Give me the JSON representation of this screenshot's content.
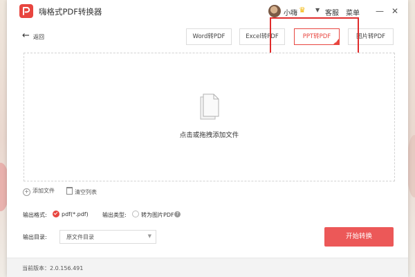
{
  "app": {
    "title": "嗨格式PDF转换器"
  },
  "user": {
    "name": "小嗨"
  },
  "header": {
    "service": "客服",
    "menu": "菜单",
    "minimize": "—",
    "close": "✕"
  },
  "nav": {
    "back_label": "返回"
  },
  "tabs": [
    {
      "label": "Word转PDF",
      "active": false
    },
    {
      "label": "Excel转PDF",
      "active": false
    },
    {
      "label": "PPT转PDF",
      "active": true
    },
    {
      "label": "图片转PDF",
      "active": false
    }
  ],
  "dropzone": {
    "text": "点击或拖拽添加文件"
  },
  "list_actions": {
    "add": "添加文件",
    "clear": "清空列表"
  },
  "options": {
    "format_label": "输出格式:",
    "format_value": "pdf(*.pdf)",
    "type_label": "输出类型:",
    "type_option": "转为图片PDF"
  },
  "output": {
    "dir_label": "输出目录:",
    "dir_value": "原文件目录"
  },
  "start_button": "开始转换",
  "footer": {
    "version": "当前版本：2.0.156.491"
  },
  "colors": {
    "accent": "#e8453f",
    "highlight": "#e02b2b",
    "start_button": "#ec5858"
  }
}
